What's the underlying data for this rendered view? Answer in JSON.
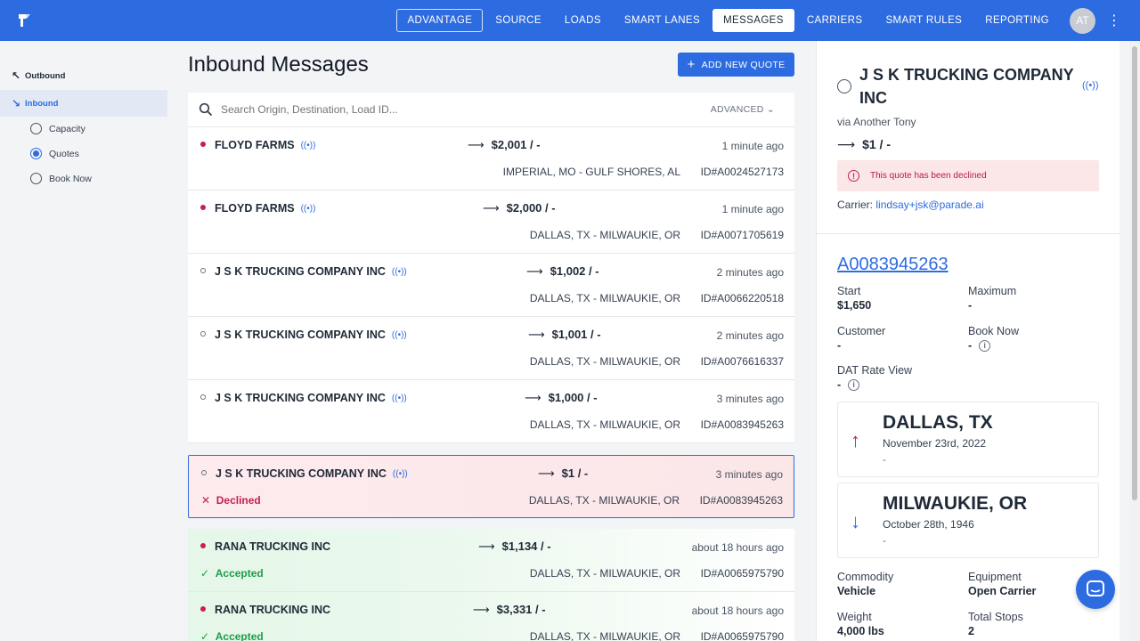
{
  "nav": {
    "items": [
      {
        "label": "ADVANTAGE",
        "style": "outlined"
      },
      {
        "label": "SOURCE",
        "style": "normal"
      },
      {
        "label": "LOADS",
        "style": "normal"
      },
      {
        "label": "SMART LANES",
        "style": "normal"
      },
      {
        "label": "MESSAGES",
        "style": "active"
      },
      {
        "label": "CARRIERS",
        "style": "normal"
      },
      {
        "label": "SMART RULES",
        "style": "normal"
      },
      {
        "label": "REPORTING",
        "style": "normal"
      }
    ],
    "avatar_initials": "AT"
  },
  "sidebar": {
    "outbound": "Outbound",
    "inbound": "Inbound",
    "filters": [
      {
        "label": "Capacity",
        "selected": false
      },
      {
        "label": "Quotes",
        "selected": true
      },
      {
        "label": "Book Now",
        "selected": false
      }
    ]
  },
  "main": {
    "title": "Inbound Messages",
    "add_button": "ADD NEW QUOTE",
    "search_placeholder": "Search Origin, Destination, Load ID...",
    "advanced_label": "ADVANCED",
    "rows": [
      {
        "carrier": "FLOYD FARMS",
        "price": "$2,001 / -",
        "time": "1 minute ago",
        "lane": "IMPERIAL, MO - GULF SHORES, AL",
        "load_id": "ID#A0024527173",
        "unread": true,
        "status": ""
      },
      {
        "carrier": "FLOYD FARMS",
        "price": "$2,000 / -",
        "time": "1 minute ago",
        "lane": "DALLAS, TX - MILWAUKIE, OR",
        "load_id": "ID#A0071705619",
        "unread": true,
        "status": ""
      },
      {
        "carrier": "J S K TRUCKING COMPANY INC",
        "price": "$1,002 / -",
        "time": "2 minutes ago",
        "lane": "DALLAS, TX - MILWAUKIE, OR",
        "load_id": "ID#A0066220518",
        "unread": false,
        "status": ""
      },
      {
        "carrier": "J S K TRUCKING COMPANY INC",
        "price": "$1,001 / -",
        "time": "2 minutes ago",
        "lane": "DALLAS, TX - MILWAUKIE, OR",
        "load_id": "ID#A0076616337",
        "unread": false,
        "status": ""
      },
      {
        "carrier": "J S K TRUCKING COMPANY INC",
        "price": "$1,000 / -",
        "time": "3 minutes ago",
        "lane": "DALLAS, TX - MILWAUKIE, OR",
        "load_id": "ID#A0083945263",
        "unread": false,
        "status": ""
      }
    ],
    "selected_row": {
      "carrier": "J S K TRUCKING COMPANY INC",
      "price": "$1 / -",
      "time": "3 minutes ago",
      "lane": "DALLAS, TX - MILWAUKIE, OR",
      "load_id": "ID#A0083945263",
      "status": "Declined"
    },
    "accepted_rows": [
      {
        "carrier": "RANA TRUCKING INC",
        "price": "$1,134 / -",
        "time": "about 18 hours ago",
        "lane": "DALLAS, TX - MILWAUKIE, OR",
        "load_id": "ID#A0065975790",
        "status": "Accepted"
      },
      {
        "carrier": "RANA TRUCKING INC",
        "price": "$3,331 / -",
        "time": "about 18 hours ago",
        "lane": "DALLAS, TX - MILWAUKIE, OR",
        "load_id": "ID#A0065975790",
        "status": "Accepted"
      }
    ]
  },
  "panel": {
    "carrier": "J S K TRUCKING COMPANY INC",
    "via": "via Another Tony",
    "price": "$1 / -",
    "alert": "This quote has been declined",
    "carrier_label": "Carrier:",
    "carrier_email": "lindsay+jsk@parade.ai",
    "load_id": "A0083945263",
    "start_label": "Start",
    "start_value": "$1,650",
    "maximum_label": "Maximum",
    "maximum_value": "-",
    "customer_label": "Customer",
    "customer_value": "-",
    "booknow_label": "Book Now",
    "booknow_value": "-",
    "dat_label": "DAT Rate View",
    "dat_value": "-",
    "origin_city": "DALLAS, TX",
    "origin_date": "November 23rd, 2022",
    "origin_extra": "-",
    "dest_city": "MILWAUKIE, OR",
    "dest_date": "October 28th, 1946",
    "dest_extra": "-",
    "commodity_label": "Commodity",
    "commodity_value": "Vehicle",
    "equipment_label": "Equipment",
    "equipment_value": "Open Carrier",
    "weight_label": "Weight",
    "weight_value": "4,000 lbs",
    "stops_label": "Total Stops",
    "stops_value": "2"
  },
  "colors": {
    "brand": "#2d6be0",
    "declined": "#c81e4b",
    "accepted": "#1f9d4a"
  }
}
